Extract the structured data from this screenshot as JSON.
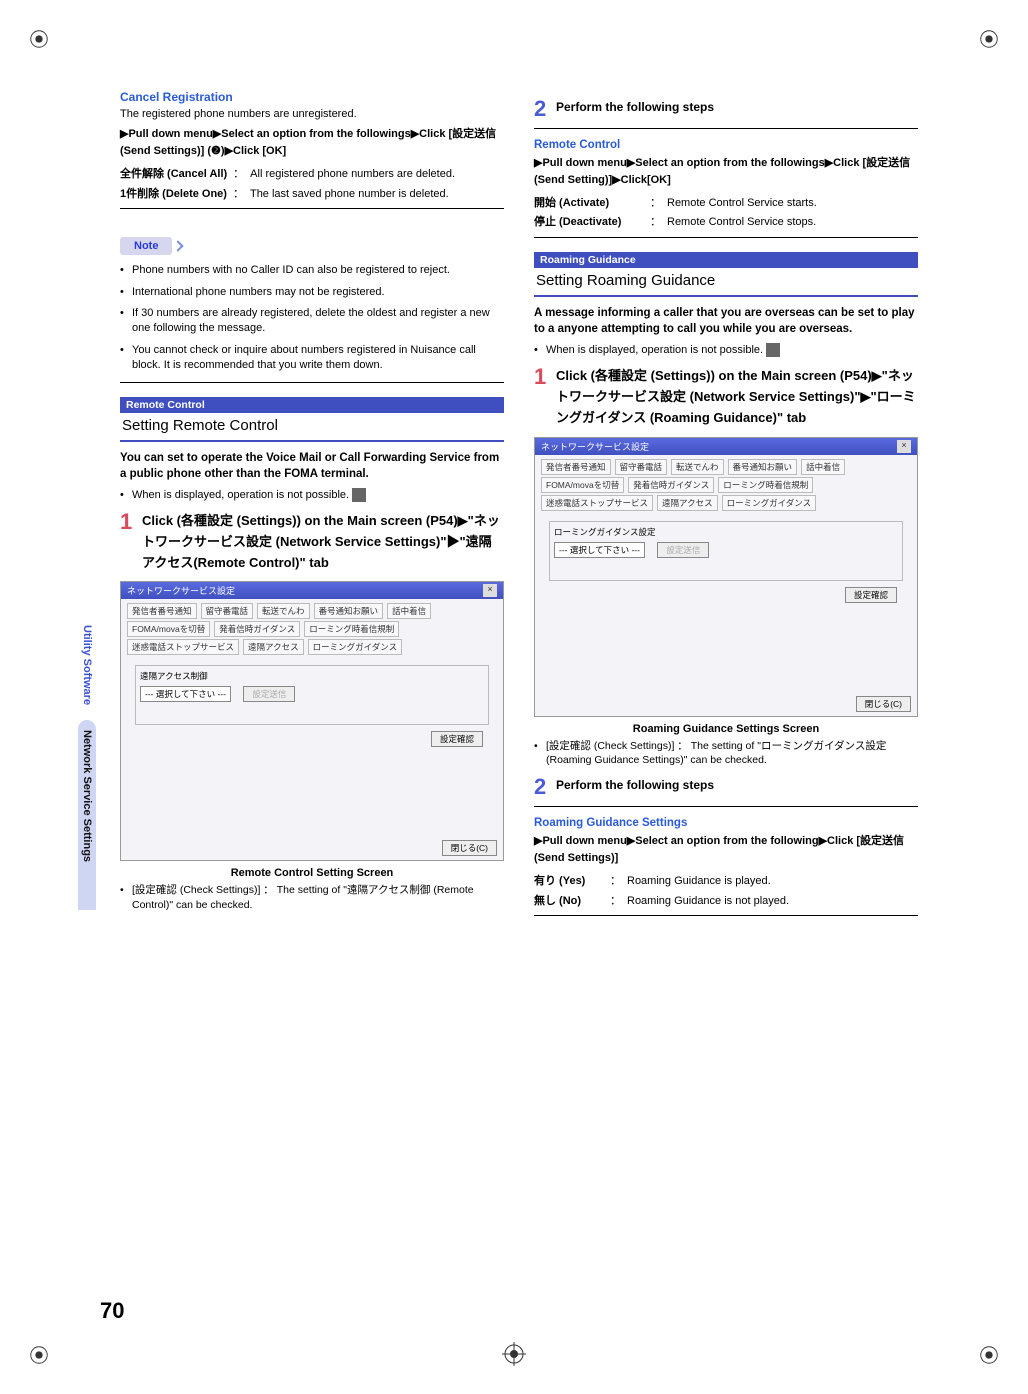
{
  "sidebar": {
    "top_label": "Utility Software",
    "bottom_label": "Network Service Settings"
  },
  "page_number": "70",
  "left": {
    "cancel_reg": {
      "title": "Cancel Registration",
      "desc": "The registered phone numbers are unregistered.",
      "instr": "▶Pull down menu▶Select an option from the followings▶Click [設定送信 (Send Settings)] (❷)▶Click [OK]",
      "rows": [
        {
          "term": "全件解除 (Cancel All)",
          "def": "All registered phone numbers are deleted."
        },
        {
          "term": "1件削除 (Delete One)",
          "def": "The last saved phone number is deleted."
        }
      ]
    },
    "note_label": "Note",
    "notes": [
      "Phone numbers with no Caller ID can also be registered to reject.",
      "International phone numbers may not be registered.",
      "If 30 numbers are already registered, delete the oldest and register a new one following the message.",
      "You cannot check or inquire about numbers registered in Nuisance call block. It is recommended that you write them down."
    ],
    "remote_box": {
      "header": "Remote Control",
      "title": "Setting Remote Control"
    },
    "remote_intro": "You can set to operate the Voice Mail or Call Forwarding Service from a public phone other than the FOMA terminal.",
    "remote_when": "When       is displayed, operation is not possible.",
    "remote_step1": "Click        (各種設定 (Settings)) on the Main screen (P54)▶\"ネットワークサービス設定 (Network Service Settings)\"▶\"遠隔アクセス(Remote Control)\" tab",
    "ss_remote": {
      "title": "ネットワークサービス設定",
      "tabs": [
        "発信者番号通知",
        "留守番電話",
        "転送でんわ",
        "番号通知お願い",
        "話中着信",
        "FOMA/movaを切替",
        "発着信時ガイダンス",
        "ローミング時着信規制",
        "迷惑電話ストップサービス",
        "遠隔アクセス",
        "ローミングガイダンス"
      ],
      "frame_label": "遠隔アクセス制御",
      "dropdown": "--- 選択して下さい ---",
      "btn_send": "設定送信",
      "btn_check": "設定確認",
      "btn_close": "閉じる(C)",
      "caption": "Remote Control Setting Screen"
    },
    "remote_sub": "[設定確認 (Check Settings)] ： The setting of \"遠隔アクセス制御 (Remote Control)\" can be checked."
  },
  "right": {
    "step2_title": "Perform the following steps",
    "remote_settings": {
      "title": "Remote Control",
      "instr": "▶Pull down menu▶Select an option from the followings▶Click [設定送信 (Send Setting)]▶Click[OK]",
      "rows": [
        {
          "term": "開始 (Activate)",
          "def": "Remote Control Service starts."
        },
        {
          "term": "停止 (Deactivate)",
          "def": "Remote Control Service stops."
        }
      ]
    },
    "roaming_box": {
      "header": "Roaming Guidance",
      "title": "Setting Roaming Guidance"
    },
    "roaming_intro": "A message informing a caller that you are overseas can be set to play to a anyone attempting to call you while you are overseas.",
    "roaming_when": "When       is displayed, operation is not possible.",
    "roaming_step1": "Click        (各種設定 (Settings)) on the Main screen (P54)▶\"ネットワークサービス設定 (Network Service Settings)\"▶\"ローミングガイダンス (Roaming Guidance)\" tab",
    "ss_roaming": {
      "title": "ネットワークサービス設定",
      "tabs": [
        "発信者番号通知",
        "留守番電話",
        "転送でんわ",
        "番号通知お願い",
        "話中着信",
        "FOMA/movaを切替",
        "発着信時ガイダンス",
        "ローミング時着信規制",
        "迷惑電話ストップサービス",
        "遠隔アクセス",
        "ローミングガイダンス"
      ],
      "frame_label": "ローミングガイダンス設定",
      "dropdown": "--- 選択して下さい ---",
      "btn_send": "設定送信",
      "btn_check": "設定確認",
      "btn_close": "閉じる(C)",
      "caption": "Roaming Guidance Settings Screen"
    },
    "roaming_sub": "[設定確認 (Check Settings)] ： The setting of \"ローミングガイダンス設定 (Roaming Guidance Settings)\" can be checked.",
    "step2b_title": "Perform the following steps",
    "roaming_settings": {
      "title": "Roaming Guidance Settings",
      "instr": "▶Pull down menu▶Select an option from the following▶Click [設定送信 (Send Settings)]",
      "rows": [
        {
          "term": "有り (Yes)",
          "def": "Roaming Guidance is played."
        },
        {
          "term": "無し (No)",
          "def": "Roaming Guidance is not played."
        }
      ]
    }
  }
}
